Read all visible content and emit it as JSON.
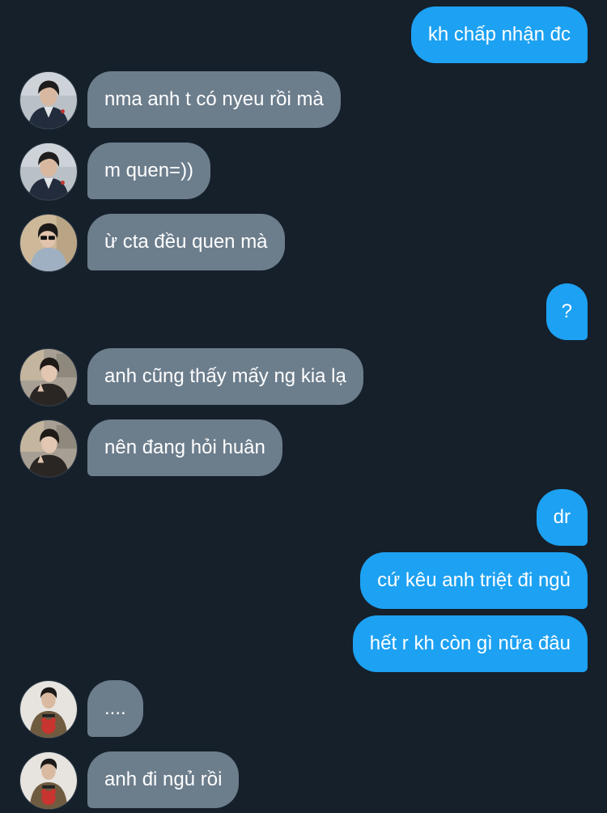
{
  "messages": [
    {
      "text": "kh chấp nhận đc"
    },
    {
      "text": "nma anh t có nyeu rồi mà"
    },
    {
      "text": "m quen=))"
    },
    {
      "text": "ừ cta đều quen mà"
    },
    {
      "text": "?"
    },
    {
      "text": "anh cũng thấy mấy ng kia lạ"
    },
    {
      "text": "nên đang hỏi huân"
    },
    {
      "text": "dr"
    },
    {
      "text": "cứ kêu anh triệt đi ngủ"
    },
    {
      "text": "hết r kh còn gì nữa đâu"
    },
    {
      "text": "...."
    },
    {
      "text": "anh đi ngủ rồi"
    }
  ],
  "colors": {
    "background": "#15202b",
    "incoming_bubble": "#6c7d8c",
    "outgoing_bubble": "#1da1f2",
    "text": "#ffffff"
  }
}
